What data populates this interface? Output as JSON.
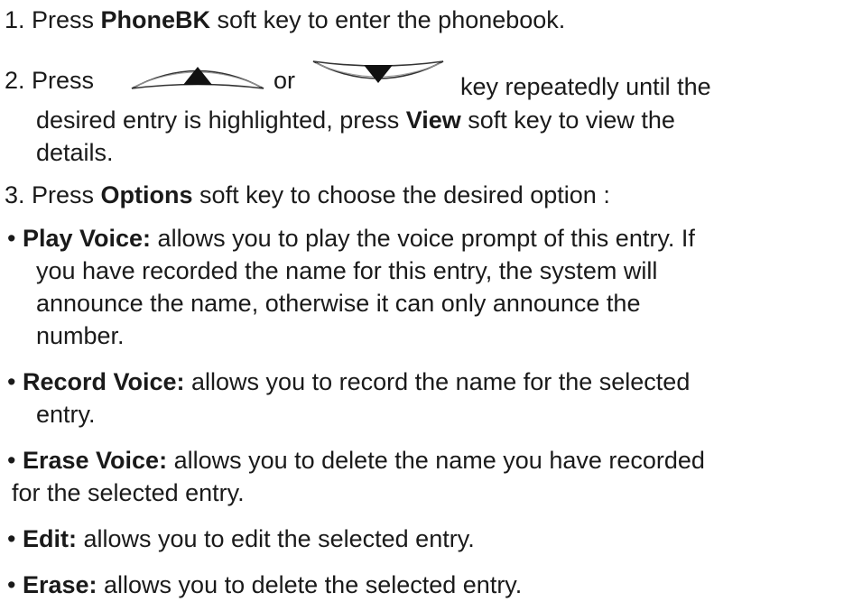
{
  "step1": {
    "num": "1. Press ",
    "bold": "PhoneBK",
    "rest": " soft key to enter the phonebook."
  },
  "step2": {
    "num": "2. Press ",
    "or": "or",
    "rest_line1": "key repeatedly until the",
    "line2_a": "desired entry is highlighted, press ",
    "line2_bold": "View",
    "line2_b": " soft key to view the",
    "line3": "details."
  },
  "step3": {
    "num": "3. Press ",
    "bold": "Options",
    "rest": " soft key to choose the desired option :"
  },
  "options": [
    {
      "bullet": "• ",
      "term": "Play Voice:",
      "line1": " allows you to play the voice prompt of this entry. If",
      "line2": "you have recorded the name for this entry, the system will",
      "line3": "announce the name, otherwise it can only announce the",
      "line4": "number."
    },
    {
      "bullet": "• ",
      "term": "Record Voice:",
      "line1": " allows you to record the name for the selected",
      "line2": "entry."
    },
    {
      "bullet": "• ",
      "term": "Erase Voice:",
      "line1": " allows you to delete the name you have recorded",
      "line2": "for the selected entry."
    },
    {
      "bullet": "• ",
      "term": "Edit:",
      "line1": " allows you to edit the selected entry."
    },
    {
      "bullet": "• ",
      "term": "Erase:",
      "line1": " allows you to delete the selected entry."
    }
  ],
  "icons": {
    "up_key": "up-arrow-key-icon",
    "down_key": "down-arrow-key-icon"
  }
}
